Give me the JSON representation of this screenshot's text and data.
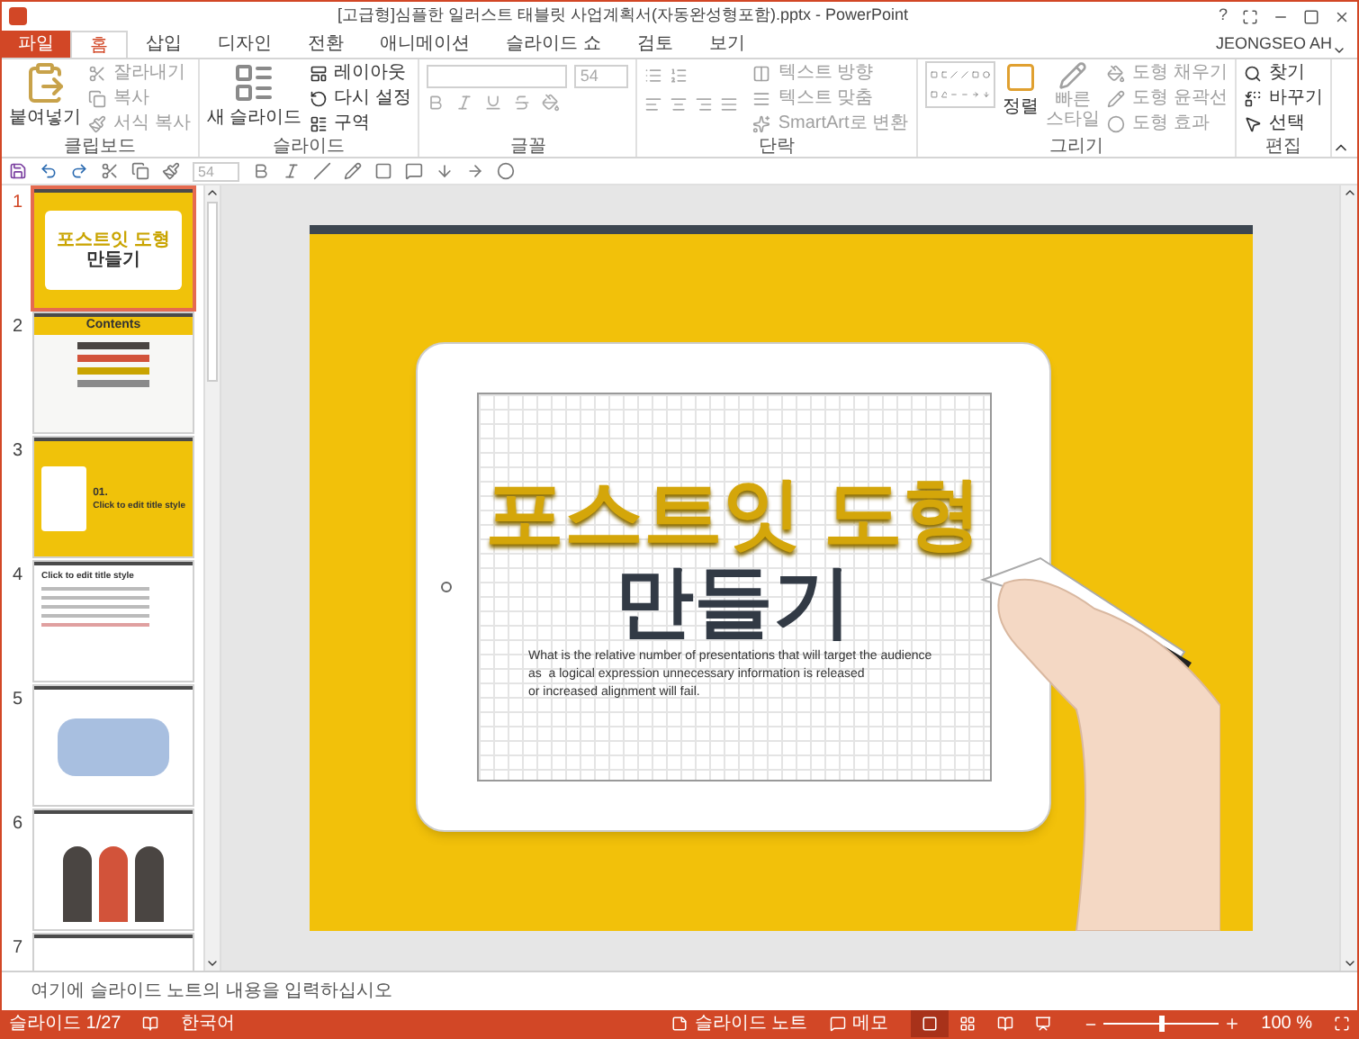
{
  "window": {
    "title": "[고급형]심플한 일러스트 태블릿 사업계획서(자동완성형포함).pptx - PowerPoint",
    "help": "?",
    "user": "JEONGSEO AH"
  },
  "tabs": [
    {
      "label": "파일",
      "kind": "file",
      "selected": false
    },
    {
      "label": "홈",
      "kind": "tab",
      "selected": true
    },
    {
      "label": "삽입",
      "kind": "tab",
      "selected": false
    },
    {
      "label": "디자인",
      "kind": "tab",
      "selected": false
    },
    {
      "label": "전환",
      "kind": "tab",
      "selected": false
    },
    {
      "label": "애니메이션",
      "kind": "tab",
      "selected": false
    },
    {
      "label": "슬라이드 쇼",
      "kind": "tab",
      "selected": false
    },
    {
      "label": "검토",
      "kind": "tab",
      "selected": false
    },
    {
      "label": "보기",
      "kind": "tab",
      "selected": false
    }
  ],
  "ribbon": [
    {
      "kind": "clipboard",
      "label": "클립보드",
      "large": "붙여넣기",
      "items": [
        {
          "label": "잘라내기",
          "disabled": true
        },
        {
          "label": "복사",
          "disabled": true
        },
        {
          "label": "서식 복사",
          "disabled": true
        }
      ]
    },
    {
      "kind": "slides",
      "label": "슬라이드",
      "large": "새 슬라이드",
      "items": [
        {
          "label": "레이아웃",
          "disabled": false
        },
        {
          "label": "다시 설정",
          "disabled": false
        },
        {
          "label": "구역",
          "disabled": false
        }
      ]
    },
    {
      "kind": "font",
      "label": "글꼴",
      "font_size": "54"
    },
    {
      "kind": "paragraph",
      "label": "단락",
      "items": [
        {
          "label": "텍스트 방향",
          "disabled": true
        },
        {
          "label": "텍스트 맞춤",
          "disabled": true
        },
        {
          "label": "SmartArt로 변환",
          "disabled": true
        }
      ]
    },
    {
      "kind": "drawing",
      "label": "그리기",
      "large": "정렬",
      "large2": "빠른",
      "large2b": "스타일",
      "items": [
        {
          "label": "도형 채우기",
          "disabled": true
        },
        {
          "label": "도형 윤곽선",
          "disabled": true
        },
        {
          "label": "도형 효과",
          "disabled": true
        }
      ]
    },
    {
      "kind": "editing",
      "label": "편집",
      "items": [
        {
          "label": "찾기",
          "disabled": false
        },
        {
          "label": "바꾸기",
          "disabled": false
        },
        {
          "label": "선택",
          "disabled": false
        }
      ]
    }
  ],
  "quick_access": {
    "font_size": "54"
  },
  "thumbnails": [
    {
      "number": "1",
      "kind": "cover",
      "selected": true,
      "title": "포스트잇 도형",
      "subtitle": "만들기"
    },
    {
      "number": "2",
      "kind": "contents",
      "selected": false,
      "title": "Contents"
    },
    {
      "number": "3",
      "kind": "section",
      "selected": false,
      "title": "01.",
      "subtitle": "Click to edit title style"
    },
    {
      "number": "4",
      "kind": "text",
      "selected": false,
      "title": "Click to edit title style"
    },
    {
      "number": "5",
      "kind": "map",
      "selected": false
    },
    {
      "number": "6",
      "kind": "history",
      "selected": false
    },
    {
      "number": "7",
      "kind": "partial",
      "selected": false
    }
  ],
  "slide": {
    "title_line1": "포스트잇 도형",
    "title_line2": "만들기",
    "body": [
      "What is the relative number of presentations that will target the audience",
      "as  a logical expression unnecessary information is released",
      "or increased alignment will fail."
    ]
  },
  "notes": {
    "placeholder": "여기에 슬라이드 노트의 내용을 입력하십시오"
  },
  "status_bar": {
    "slide_counter": "슬라이드 1/27",
    "language": "한국어",
    "notes_button": "슬라이드 노트",
    "comments_button": "메모",
    "views": [
      {
        "kind": "normal",
        "selected": true
      },
      {
        "kind": "sorter",
        "selected": false
      },
      {
        "kind": "reading",
        "selected": false
      },
      {
        "kind": "show",
        "selected": false
      }
    ],
    "zoom": {
      "level": 0.5,
      "reading": "100 %"
    }
  }
}
